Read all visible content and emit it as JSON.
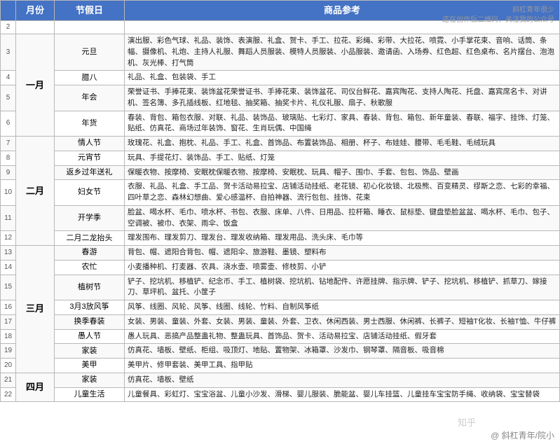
{
  "watermark": {
    "line1": "斜杠青年很少",
    "line2": "还在创作后二维码，关注我的公众号"
  },
  "zhihu_logo": "知乎",
  "zhihu_author": "@ 斜杠青年/院小",
  "headers": {
    "col_a": "月份",
    "col_b": "节假日",
    "col_c": "商品参考"
  },
  "rows": [
    {
      "row_num": "2",
      "month": "",
      "festival": "",
      "goods": ""
    },
    {
      "row_num": "3",
      "month": "一月",
      "festival": "元旦",
      "goods": "演出服、彩色气球、礼品、装饰、表演服、礼盒、贺卡、手工、拉花、彩绳、彩带、大拉花、喷霓、小手掌花束、音响、话筒、条幅、摄像机、礼炮、主持人礼服、舞蹈人员服装、模特人员服装、小品服装、邀请函、入场券、红色超、红色桌布、名片摆台、泡泡机、灰光棒、打气筒"
    },
    {
      "row_num": "4",
      "month": "",
      "festival": "腊八",
      "goods": "礼品、礼盒、包装袋、手工"
    },
    {
      "row_num": "5",
      "month": "",
      "festival": "年会",
      "goods": "荣誉证书、手捧花束、装饰盆花荣誉证书、手捧花束、装饰盆花、司仪台鲜花、嘉宾陶花、支持人陶花、托盘、嘉宾席名卡、对讲机、签名簿、多孔插线板、红地毯、抽奖箱、抽奖卡片、礼仪礼服、扇子、秋歌服"
    },
    {
      "row_num": "6",
      "month": "",
      "festival": "年货",
      "goods": "春装、背包、箱包衣服、对联、礼品、装饰品、玻璃贴、七彩灯、家具、春装、背包、箱包、新年童装、春联、福字、挂饰、灯笼、贴纸、仿真花、商场过年装饰、窗花、生肖玩偶、中国绳"
    },
    {
      "row_num": "7",
      "month": "二月",
      "festival": "情人节",
      "goods": "玫瑰花、礼盒、抱枕、礼品、手工、礼盒、首饰品、布置装饰品、相册、杯子、布娃娃、腰带、毛毛鞋、毛绒玩具"
    },
    {
      "row_num": "8",
      "month": "",
      "festival": "元宵节",
      "goods": "玩具、手提花灯、装饰品、手工、贴纸、灯笼"
    },
    {
      "row_num": "9",
      "month": "",
      "festival": "返乡过年送礼",
      "goods": "保暖衣物、按摩椅、安眠枕保暖衣物、按摩椅、安眠枕、玩具、帽子、围巾、手套、包包、饰品、壁画"
    },
    {
      "row_num": "10",
      "month": "",
      "festival": "妇女节",
      "goods": "衣服、礼品、礼盒、手工品、贺卡活动易拉宝、店铺活动挂纸、老花镜、初心化妆镜、北极熊、百变精灵、缪斯之恋、七彩的幸福、四叶草之恋、森林幻想曲、爱心感温杯、自拍神器、流行包包、挂饰、花束"
    },
    {
      "row_num": "11",
      "month": "",
      "festival": "开学季",
      "goods": "脸盆、喝水杯、毛巾、喷水杯、书包、衣服、床单、八件、日用品、拉杆箱、睡衣、鼠标垫、键盘垫脸盆盆、喝水杯、毛巾、包子、空调被、被巾、衣架、雨伞、饭盒"
    },
    {
      "row_num": "12",
      "month": "",
      "festival": "二月二龙抬头",
      "goods": "理发围布、理发剪刀、理发台、理发收纳箱、理发用品、洗头床、毛巾等"
    },
    {
      "row_num": "13",
      "month": "三月",
      "festival": "春游",
      "goods": "背包、帽、遮阳合背包、帽、遮阳伞、旅游鞋、墨镜、塑料布"
    },
    {
      "row_num": "14",
      "month": "",
      "festival": "农忙",
      "goods": "小麦播种机、打麦器、农具、浇水壶、喷雾壶、修枝剪、小铲"
    },
    {
      "row_num": "15",
      "month": "",
      "festival": "植树节",
      "goods": "铲子、挖坑机、移植铲、纪念币、手工、植树袋、挖坑机、钻地配件、许愿挂牌、指示牌、铲子、挖坑机、移植铲、抓草刀、嫁接刀、草坪机、盆托、小筐子"
    },
    {
      "row_num": "16",
      "month": "",
      "festival": "3月3放风筝",
      "goods": "风筝、线圈、风轮、风筝、线圈、线轮、竹料、自制风筝纸"
    },
    {
      "row_num": "17",
      "month": "",
      "festival": "换季春装",
      "goods": "女装、男装、童装、外套、女装、男装、童装、外套、卫衣、休闲西装、男士西服、休闲裤、长裤子、短袖T化妆、长袖T恤、牛仔裤"
    },
    {
      "row_num": "18",
      "month": "",
      "festival": "愚人节",
      "goods": "愚人玩具、恶搞产品整蛊礼物、整蛊玩具、首饰品、贺卡、活动易拉宝、店铺活动挂纸、假牙套"
    },
    {
      "row_num": "19",
      "month": "",
      "festival": "家装",
      "goods": "仿真花、墙板、壁纸、柜组、吸顶灯、地贴、置物架、冰箱罩、沙发巾、钢琴罩、隔音板、吸音棉"
    },
    {
      "row_num": "20",
      "month": "",
      "festival": "美甲",
      "goods": "美甲片、修甲套装、美甲工具、指甲贴"
    },
    {
      "row_num": "21",
      "month": "四月",
      "festival": "家装",
      "goods": "仿真花、墙板、壁纸"
    },
    {
      "row_num": "22",
      "month": "",
      "festival": "儿童生活",
      "goods": "儿童餐具、彩虹灯、宝宝浴盆、儿童小沙发、滑梯、婴儿服装、脆能盆、婴儿车挂篮、儿童挂车宝宝防手绳、收纳袋、宝宝替袋"
    }
  ]
}
